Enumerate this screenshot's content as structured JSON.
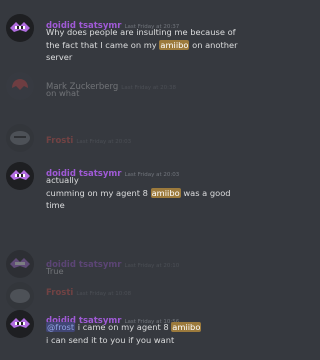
{
  "colors": {
    "background": "#36393f",
    "username_purple": "#a05ad6",
    "username_red": "#e0534b",
    "highlight": "#9c7a3c",
    "mention_bg": "#414675",
    "mention_text": "#8ea1e1"
  },
  "messages": [
    {
      "author": "doidid tsatsymr",
      "timestamp": "Last Friday at 20:37",
      "lines": [
        [
          "Why does people are insulting me because of"
        ],
        [
          "the fact that I came on my ",
          {
            "hl": "amiibo"
          },
          " on another"
        ],
        [
          "server"
        ]
      ]
    },
    {
      "author": "Mark Zuckerberg",
      "timestamp": "Last Friday at 20:38",
      "text": "on what"
    },
    {
      "author": "Frosti",
      "timestamp": "Last Friday at 20:03"
    },
    {
      "author": "doidid tsatsymr",
      "timestamp": "Last Friday at 20:03",
      "line1": "actually",
      "line2_pre": "cumming on my agent 8 ",
      "line2_hl": "amiibo",
      "line2_post": " was a good",
      "line3": "time"
    },
    {
      "author": "doidid tsatsymr",
      "timestamp": "Last Friday at 20:10",
      "text": "True"
    },
    {
      "author": "Frosti",
      "timestamp": "Last Friday at 10:08"
    },
    {
      "author": "doidid tsatsymr",
      "timestamp": "Last Friday at 10:56",
      "mention": "@frost",
      "line1_pre": " i came on my agent 8 ",
      "line1_hl": "amiibo",
      "line2": "i can send it to you if you want"
    }
  ]
}
